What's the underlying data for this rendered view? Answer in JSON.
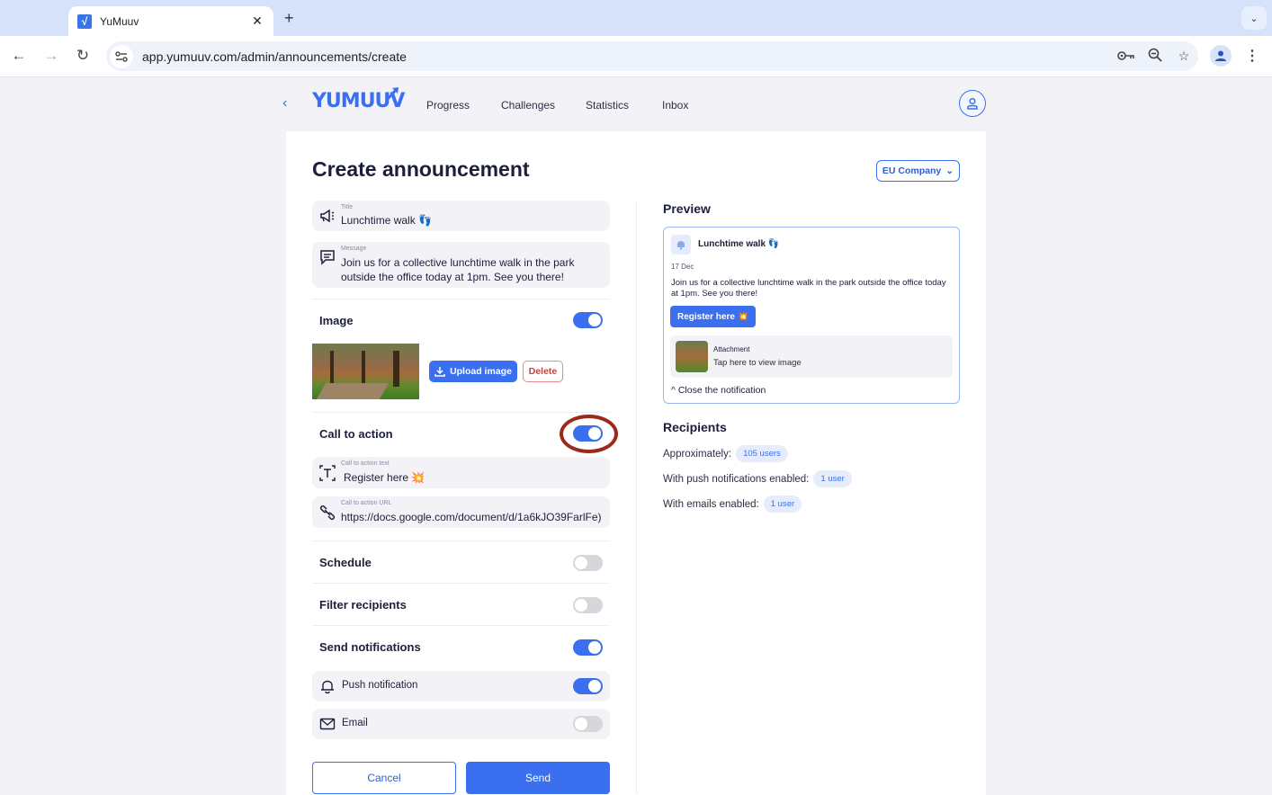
{
  "browser": {
    "tab_title": "YuMuuv",
    "tab_favicon": "√",
    "url": "app.yumuuv.com/admin/announcements/create",
    "icons": [
      "back-icon",
      "forward-icon",
      "reload-icon",
      "site-info-icon",
      "password-key-icon",
      "zoom-out-icon",
      "bookmark-star-icon",
      "profile-icon",
      "kebab-menu-icon"
    ]
  },
  "header": {
    "back_symbol": "‹",
    "logo": "YUMUUV",
    "nav": [
      {
        "label": "Progress"
      },
      {
        "label": "Challenges"
      },
      {
        "label": "Statistics"
      },
      {
        "label": "Inbox"
      }
    ]
  },
  "page": {
    "title": "Create announcement",
    "company_select": "EU Company"
  },
  "form": {
    "title_field": {
      "label": "Title",
      "value": "Lunchtime walk 👣"
    },
    "message_field": {
      "label": "Message",
      "value": "Join us for a collective lunchtime walk in the park outside the office today at 1pm. See you there!"
    },
    "image": {
      "label": "Image",
      "enabled": true,
      "upload_label": "Upload image",
      "delete_label": "Delete"
    },
    "call_to_action": {
      "label": "Call to action",
      "enabled": true,
      "text_field": {
        "label": "Call to action text",
        "value": "Register here 💥"
      },
      "url_field": {
        "label": "Call to action URL",
        "value": "https://docs.google.com/document/d/1a6kJO39FarlFe)"
      }
    },
    "schedule": {
      "label": "Schedule",
      "enabled": false
    },
    "filter_recipients": {
      "label": "Filter recipients",
      "enabled": false
    },
    "send_notifications": {
      "label": "Send notifications",
      "enabled": true,
      "push": {
        "label": "Push notification",
        "enabled": true
      },
      "email": {
        "label": "Email",
        "enabled": false
      }
    },
    "cancel_label": "Cancel",
    "send_label": "Send"
  },
  "preview": {
    "heading": "Preview",
    "title": "Lunchtime walk 👣",
    "date": "17 Dec",
    "message": "Join us for a collective lunchtime walk in the park outside the office today at 1pm. See you there!",
    "cta": "Register here 💥",
    "attachment_label": "Attachment",
    "attachment_sub": "Tap here to view image",
    "close_label": "^  Close the notification"
  },
  "recipients": {
    "heading": "Recipients",
    "rows": [
      {
        "label": "Approximately:",
        "value": "105 users"
      },
      {
        "label": "With push notifications enabled:",
        "value": "1 user"
      },
      {
        "label": "With emails enabled:",
        "value": "1 user"
      }
    ]
  },
  "colors": {
    "accent": "#3a6ff0",
    "danger": "#d33a3a",
    "highlight_ring": "#9c2a1c"
  }
}
